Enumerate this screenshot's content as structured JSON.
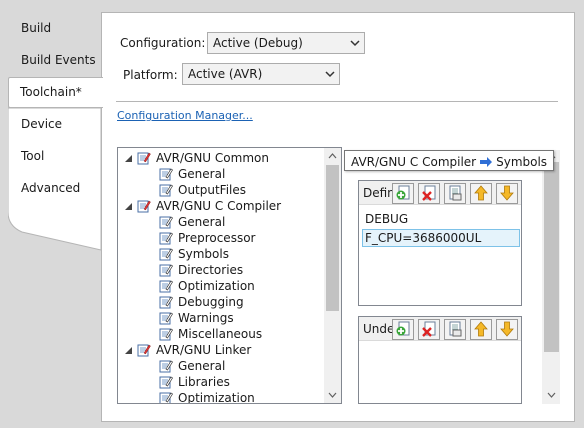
{
  "sidebar": {
    "items": [
      {
        "label": "Build"
      },
      {
        "label": "Build Events"
      },
      {
        "label": "Toolchain*",
        "active": true
      },
      {
        "label": "Device"
      },
      {
        "label": "Tool"
      },
      {
        "label": "Advanced"
      }
    ]
  },
  "settings": {
    "configuration_label": "Configuration:",
    "configuration_value": "Active (Debug)",
    "platform_label": "Platform:",
    "platform_value": "Active (AVR)",
    "config_manager_link": "Configuration Manager..."
  },
  "tree": {
    "nodes": [
      {
        "label": "AVR/GNU Common",
        "children": [
          "General",
          "OutputFiles"
        ]
      },
      {
        "label": "AVR/GNU C Compiler",
        "children": [
          "General",
          "Preprocessor",
          "Symbols",
          "Directories",
          "Optimization",
          "Debugging",
          "Warnings",
          "Miscellaneous"
        ]
      },
      {
        "label": "AVR/GNU Linker",
        "children": [
          "General",
          "Libraries",
          "Optimization"
        ]
      }
    ]
  },
  "tooltip": {
    "left": "AVR/GNU C Compiler",
    "right": "Symbols"
  },
  "defines": {
    "title": "Defin",
    "items": [
      "DEBUG",
      "F_CPU=3686000UL"
    ],
    "selected_index": 1
  },
  "undefines": {
    "title": "Unde",
    "items": []
  },
  "icons": {
    "toolbar": [
      "add-icon",
      "delete-icon",
      "edit-icon",
      "move-up-icon",
      "move-down-icon"
    ],
    "tree_page": "edit-page-icon"
  },
  "colors": {
    "link": "#1b62b4",
    "selection_fill": "#e5f3fb",
    "selection_border": "#7dc2e8",
    "tooltip_arrow": "#2f6fd6"
  }
}
